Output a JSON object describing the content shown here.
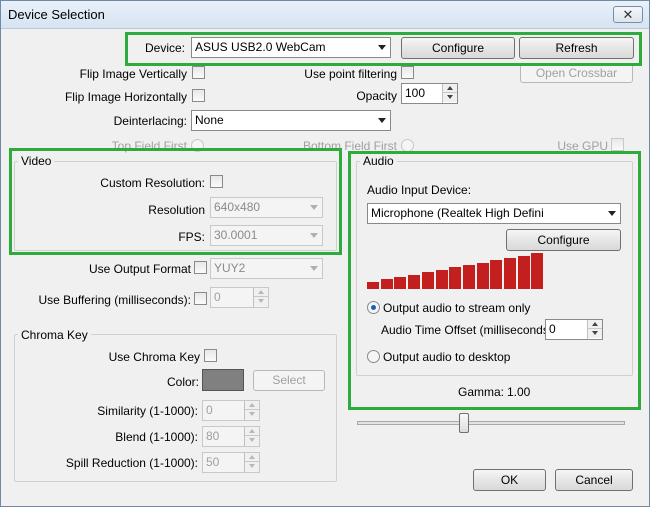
{
  "window": {
    "title": "Device Selection",
    "close_glyph": "✕"
  },
  "device": {
    "label": "Device:",
    "selected": "ASUS USB2.0 WebCam",
    "configure": "Configure",
    "refresh": "Refresh"
  },
  "options": {
    "flip_vertical": "Flip Image Vertically",
    "flip_horizontal": "Flip Image Horizontally",
    "use_point_filtering": "Use point filtering",
    "opacity_label": "Opacity",
    "opacity_value": "100",
    "open_crossbar": "Open Crossbar",
    "deinterlacing_label": "Deinterlacing:",
    "deinterlacing_value": "None",
    "top_field_first": "Top Field First",
    "bottom_field_first": "Bottom Field First",
    "use_gpu": "Use GPU"
  },
  "video": {
    "title": "Video",
    "custom_resolution": "Custom Resolution:",
    "resolution_label": "Resolution",
    "resolution_value": "640x480",
    "fps_label": "FPS:",
    "fps_value": "30.0001"
  },
  "output": {
    "use_output_format": "Use Output Format",
    "format_value": "YUY2",
    "use_buffering": "Use Buffering (milliseconds):",
    "buffering_value": "0"
  },
  "chroma": {
    "title": "Chroma Key",
    "use_chroma_key": "Use Chroma Key",
    "color_label": "Color:",
    "select": "Select",
    "similarity_label": "Similarity (1-1000):",
    "similarity_value": "0",
    "blend_label": "Blend (1-1000):",
    "blend_value": "80",
    "spill_label": "Spill Reduction (1-1000):",
    "spill_value": "50"
  },
  "audio": {
    "title": "Audio",
    "input_device_label": "Audio Input Device:",
    "input_device_value": "Microphone (Realtek High Defini",
    "configure": "Configure",
    "meter_levels": [
      0.2,
      0.27,
      0.33,
      0.4,
      0.47,
      0.53,
      0.6,
      0.67,
      0.73,
      0.8,
      0.87,
      0.93,
      1.0
    ],
    "meter_color": "#c41f1f",
    "output_stream_only": "Output audio to stream only",
    "time_offset_label": "Audio Time Offset (milliseconds):",
    "time_offset_value": "0",
    "output_desktop": "Output audio to desktop"
  },
  "gamma": {
    "label": "Gamma:",
    "value": "1.00",
    "slider_level": 0.4
  },
  "footer": {
    "ok": "OK",
    "cancel": "Cancel"
  },
  "highlight_color": "#2faa3c"
}
